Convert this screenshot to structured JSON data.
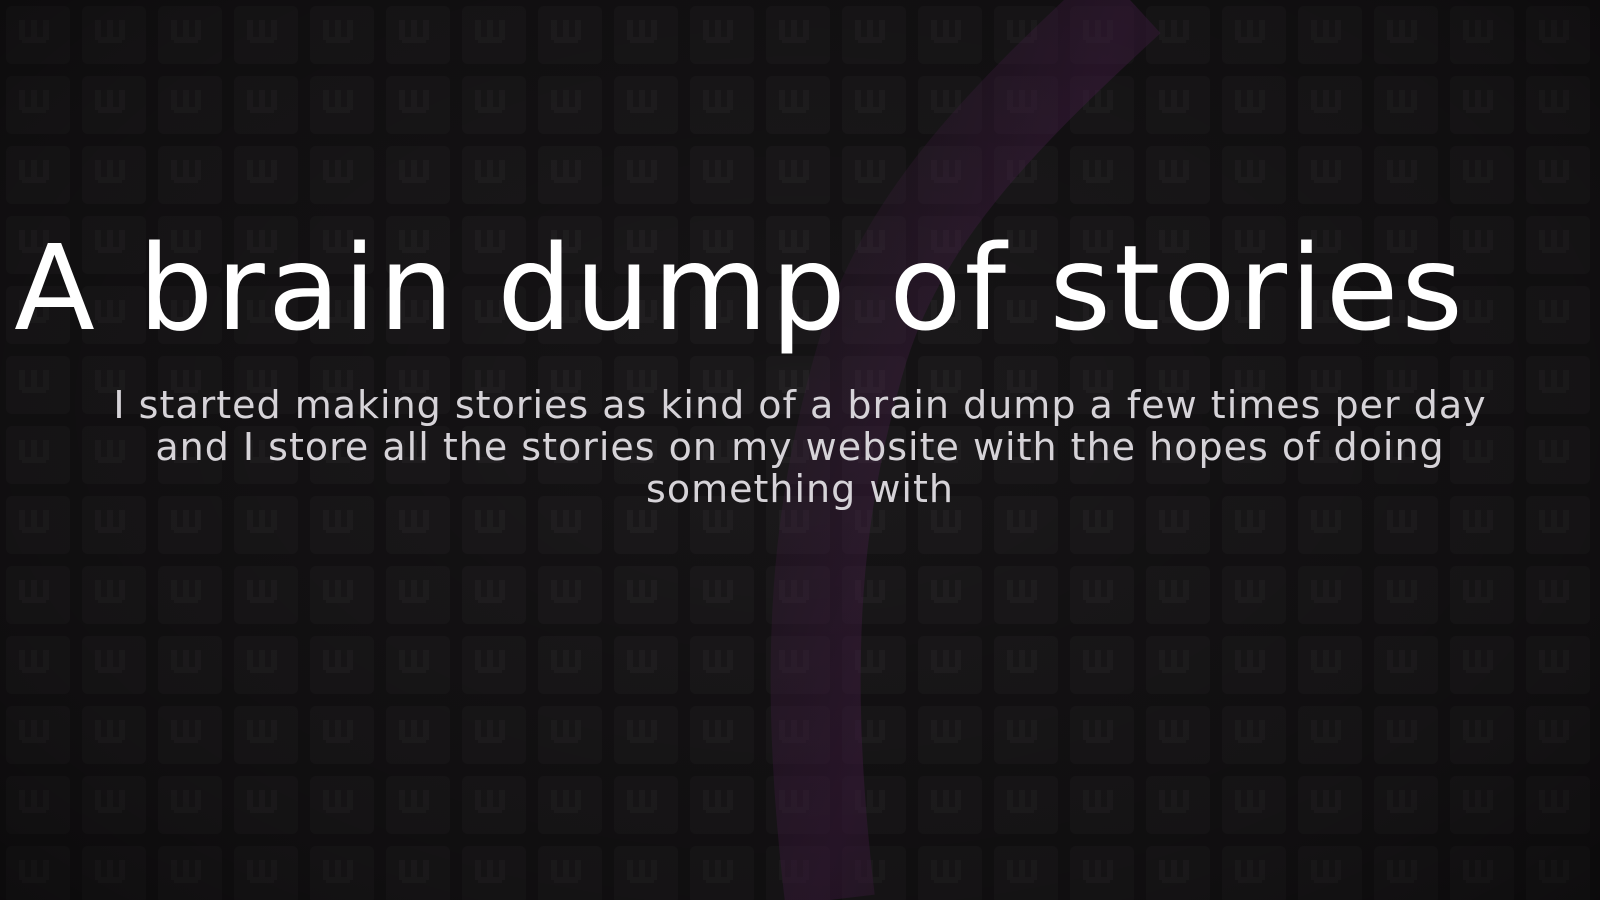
{
  "title": "A brain dump of stories",
  "description": "I started making stories as kind of a brain dump a few times per day and I store all the stories on my website with the hopes of doing something with",
  "colors": {
    "background": "#151315",
    "tile": "#1b191b",
    "accent_purple": "#4a1f4c",
    "title_text": "#ffffff",
    "description_text": "#d6d3d8"
  },
  "background_pattern": "dark-keyboard-tile-grid-with-purple-glow"
}
